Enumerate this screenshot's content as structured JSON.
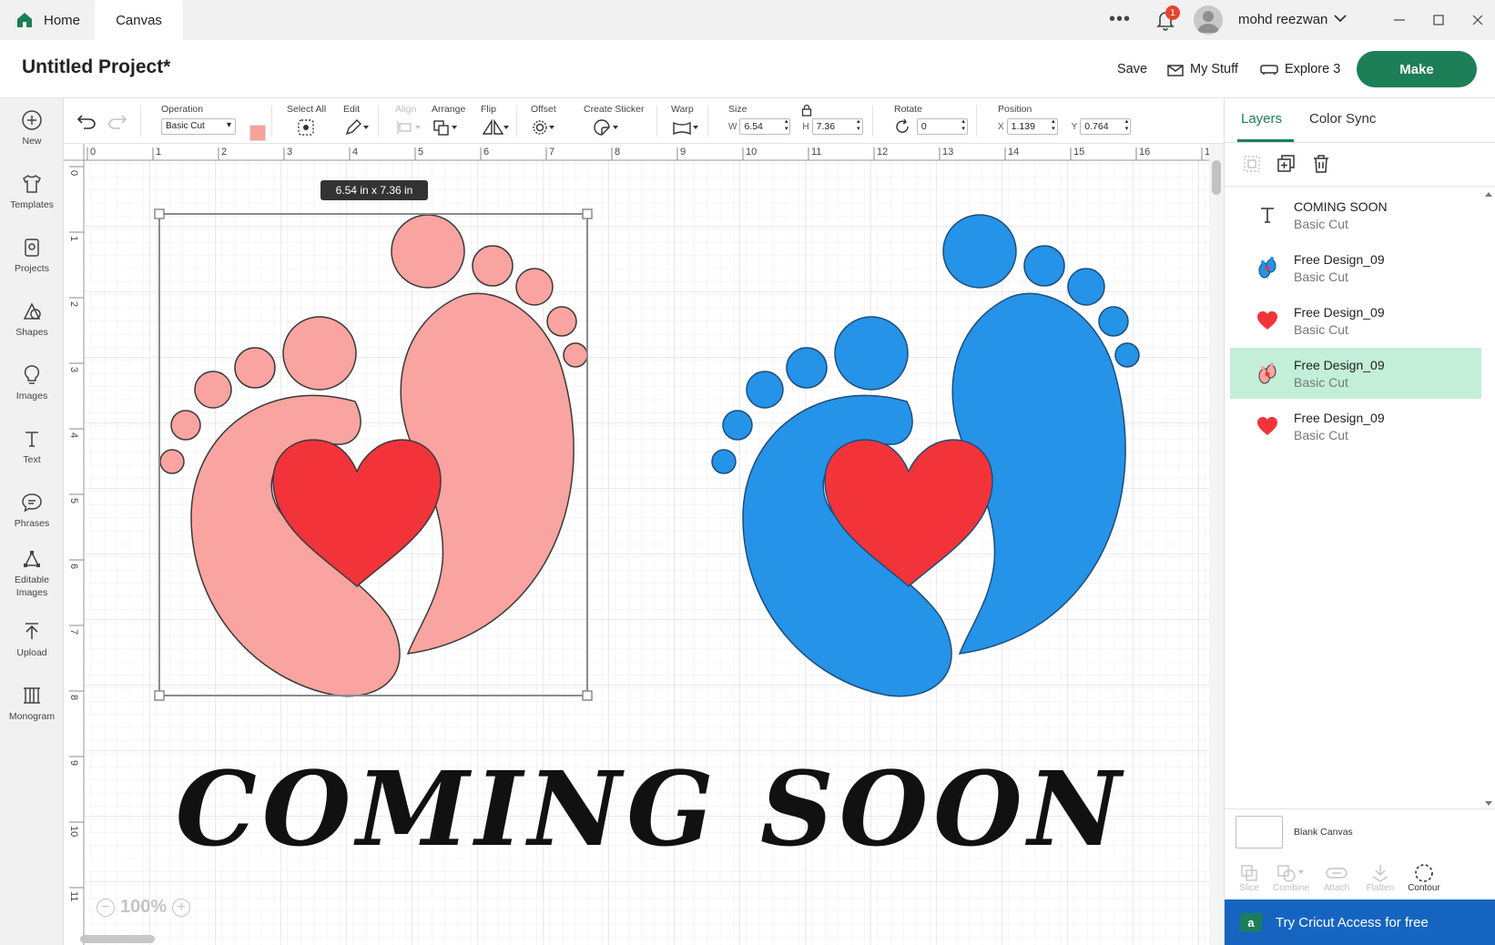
{
  "tabs": {
    "home": "Home",
    "canvas": "Canvas"
  },
  "topbar": {
    "notification_count": "1",
    "username": "mohd reezwan"
  },
  "project": {
    "title": "Untitled Project*",
    "save": "Save",
    "my_stuff": "My Stuff",
    "machine": "Explore 3",
    "make": "Make"
  },
  "sidebar": {
    "items": [
      "New",
      "Templates",
      "Projects",
      "Shapes",
      "Images",
      "Text",
      "Phrases",
      "Editable Images",
      "Upload",
      "Monogram"
    ]
  },
  "toolbar": {
    "operation_label": "Operation",
    "operation_value": "Basic Cut",
    "operation_color": "#f9a19d",
    "select_all": "Select All",
    "edit": "Edit",
    "align": "Align",
    "arrange": "Arrange",
    "flip": "Flip",
    "offset": "Offset",
    "create_sticker": "Create Sticker",
    "warp": "Warp",
    "size_label": "Size",
    "w_label": "W",
    "w_value": "6.54",
    "h_label": "H",
    "h_value": "7.36",
    "rotate_label": "Rotate",
    "rotate_value": "0",
    "position_label": "Position",
    "x_label": "X",
    "x_value": "1.139",
    "y_label": "Y",
    "y_value": "0.764"
  },
  "canvas": {
    "ruler_h": [
      "0",
      "1",
      "2",
      "3",
      "4",
      "5",
      "6",
      "7",
      "8",
      "9",
      "10",
      "11",
      "12",
      "13",
      "14",
      "15",
      "16",
      "1"
    ],
    "ruler_v": [
      "0",
      "1",
      "2",
      "3",
      "4",
      "5",
      "6",
      "7",
      "8",
      "9",
      "10",
      "11"
    ],
    "size_tag": "6.54  in x 7.36  in",
    "zoom": "100%",
    "text_art": "COMING SOON",
    "colors": {
      "pink": "#f9a4a0",
      "blue": "#2593e8",
      "red": "#f2343a"
    }
  },
  "panel": {
    "tab_layers": "Layers",
    "tab_color_sync": "Color Sync",
    "layers": [
      {
        "name": "COMING SOON",
        "op": "Basic Cut",
        "icon": "text-icon"
      },
      {
        "name": "Free Design_09",
        "op": "Basic Cut",
        "icon": "blue-feet-icon"
      },
      {
        "name": "Free Design_09",
        "op": "Basic Cut",
        "icon": "heart-icon"
      },
      {
        "name": "Free Design_09",
        "op": "Basic Cut",
        "icon": "pink-feet-icon"
      },
      {
        "name": "Free Design_09",
        "op": "Basic Cut",
        "icon": "heart-icon"
      }
    ],
    "blank_canvas": "Blank Canvas",
    "tools": [
      "Slice",
      "Combine",
      "Attach",
      "Flatten",
      "Contour"
    ],
    "access": "Try Cricut Access for free"
  }
}
